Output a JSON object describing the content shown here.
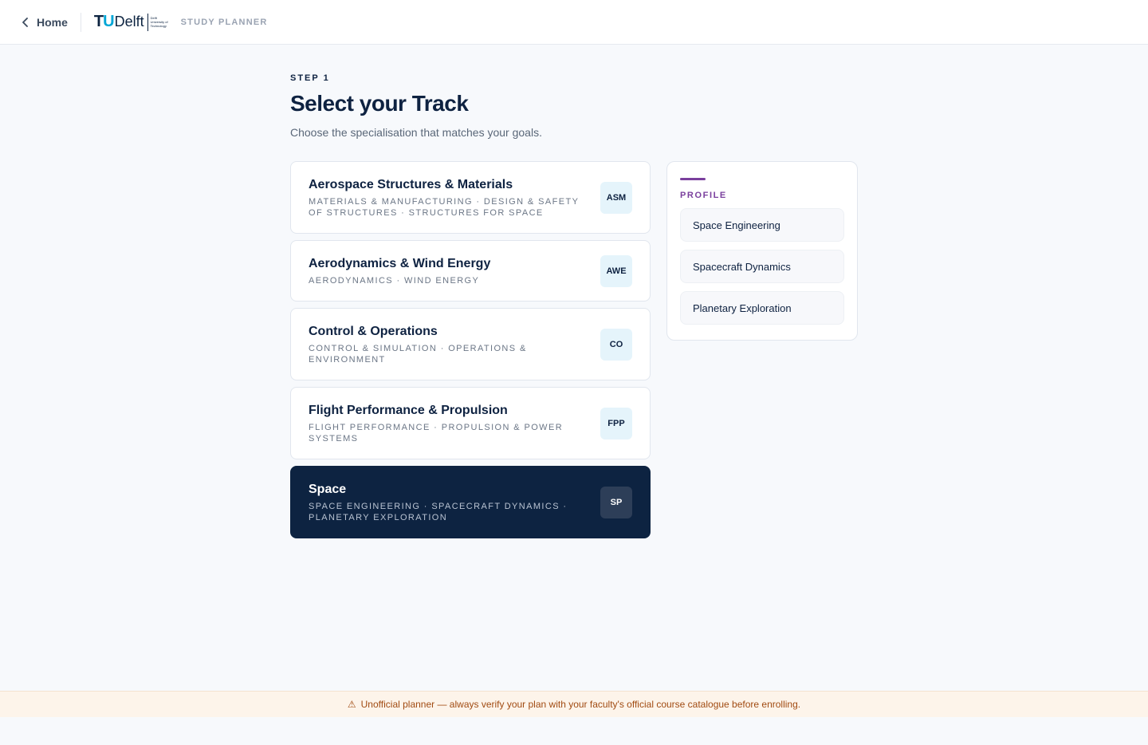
{
  "header": {
    "home_label": "Home",
    "logo_tu": "TU",
    "logo_delft": "Delft",
    "logo_sub_1": "Delft",
    "logo_sub_2": "University of",
    "logo_sub_3": "Technology",
    "planner_label": "STUDY PLANNER"
  },
  "main": {
    "step": "STEP 1",
    "title": "Select your Track",
    "subtitle": "Choose the specialisation that matches your goals."
  },
  "tracks": [
    {
      "name": "Aerospace Structures & Materials",
      "areas": "Materials & Manufacturing · Design & Safety of Structures · Structures for Space",
      "badge": "ASM"
    },
    {
      "name": "Aerodynamics & Wind Energy",
      "areas": "Aerodynamics · Wind Energy",
      "badge": "AWE"
    },
    {
      "name": "Control & Operations",
      "areas": "Control & Simulation · Operations & Environment",
      "badge": "CO"
    },
    {
      "name": "Flight Performance & Propulsion",
      "areas": "Flight Performance · Propulsion & Power Systems",
      "badge": "FPP"
    },
    {
      "name": "Space",
      "areas": "Space Engineering · Spacecraft Dynamics · Planetary Exploration",
      "badge": "SP"
    }
  ],
  "selected_track": "Space",
  "profile": {
    "label": "PROFILE",
    "items": [
      "Space Engineering",
      "Spacecraft Dynamics",
      "Planetary Exploration"
    ]
  },
  "footer": {
    "icon": "warning-icon",
    "text": "Unofficial planner — always verify your plan with your faculty's official course catalogue before enrolling."
  },
  "colors": {
    "navy": "#0d2341",
    "accent_blue": "#00a6d6",
    "profile_purple": "#7a3f9d",
    "warning_text": "#a14b12"
  }
}
